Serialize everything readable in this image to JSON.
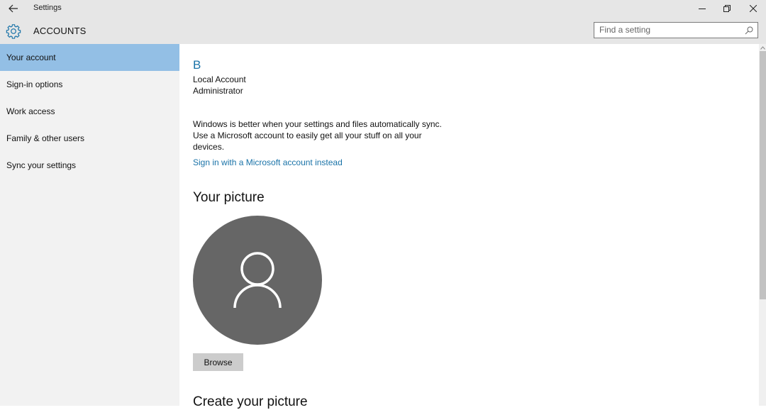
{
  "window": {
    "title": "Settings",
    "controls": {
      "minimize": "minimize",
      "restore": "restore",
      "close": "close"
    }
  },
  "header": {
    "section_title": "ACCOUNTS",
    "icon": "gear-icon",
    "search": {
      "placeholder": "Find a setting",
      "value": ""
    }
  },
  "sidebar": {
    "items": [
      {
        "label": "Your account",
        "active": true
      },
      {
        "label": "Sign-in options",
        "active": false
      },
      {
        "label": "Work access",
        "active": false
      },
      {
        "label": "Family & other users",
        "active": false
      },
      {
        "label": "Sync your settings",
        "active": false
      }
    ]
  },
  "account": {
    "initial": "B",
    "type": "Local Account",
    "role": "Administrator",
    "sync_message": "Windows is better when your settings and files automatically sync. Use a Microsoft account to easily get all your stuff on all your devices.",
    "signin_link": "Sign in with a Microsoft account instead"
  },
  "picture": {
    "heading": "Your picture",
    "browse_label": "Browse"
  },
  "create_picture": {
    "heading": "Create your picture"
  },
  "colors": {
    "accent": "#1a73a8",
    "nav_selected": "#93bfe5",
    "avatar_bg": "#666666"
  },
  "scroll": {
    "position_fraction": 0.0,
    "visible_fraction": 0.69
  }
}
